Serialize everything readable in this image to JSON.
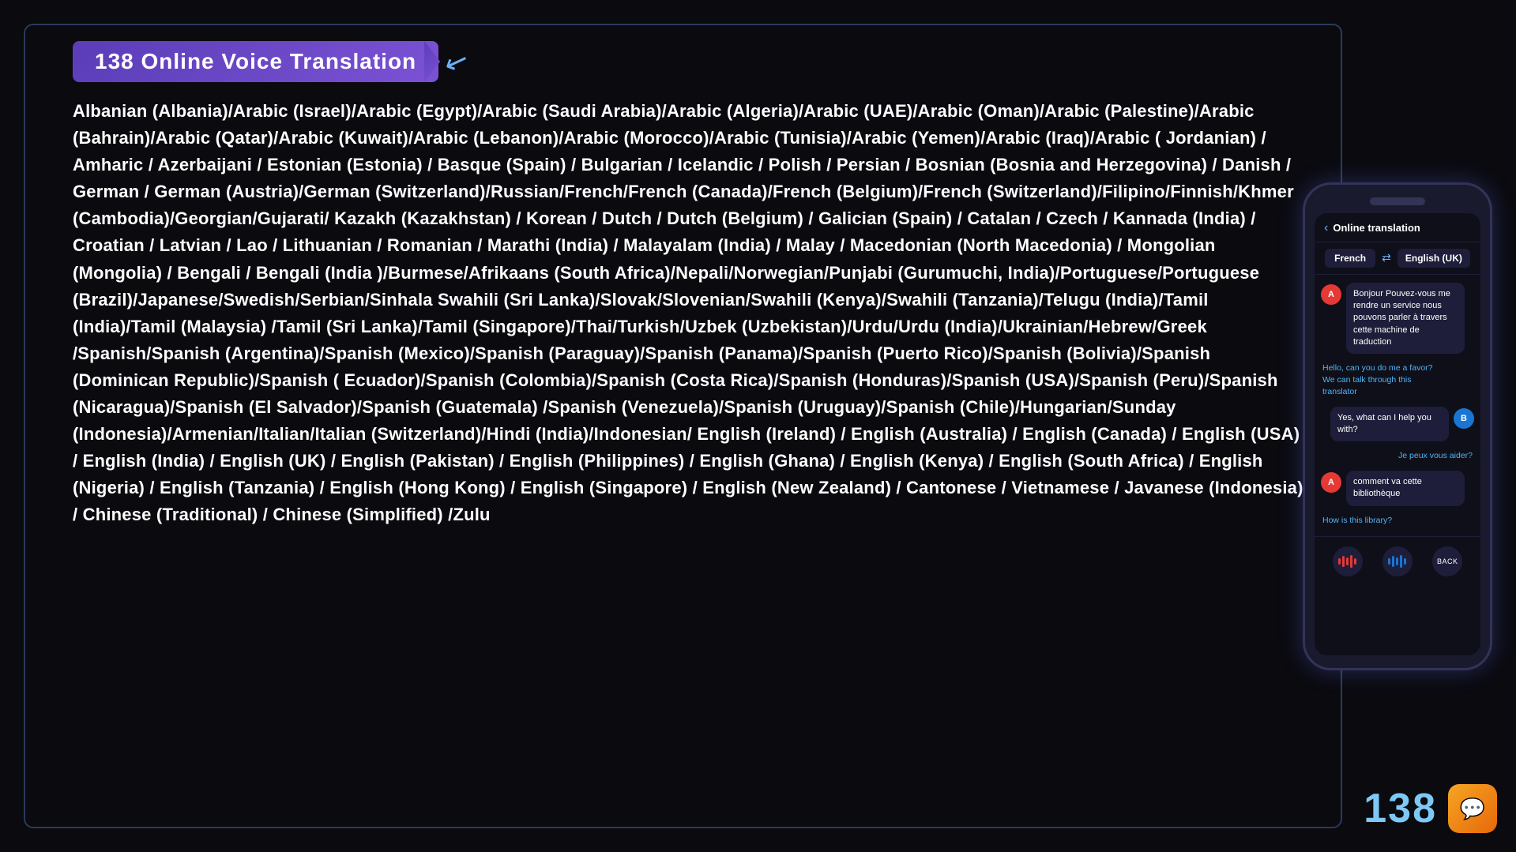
{
  "header": {
    "banner_title": "138 Online Voice Translation",
    "border_color": "#2a3a5c"
  },
  "languages_text": "Albanian (Albania)/Arabic (Israel)/Arabic (Egypt)/Arabic (Saudi Arabia)/Arabic (Algeria)/Arabic (UAE)/Arabic (Oman)/Arabic (Palestine)/Arabic (Bahrain)/Arabic (Qatar)/Arabic (Kuwait)/Arabic (Lebanon)/Arabic (Morocco)/Arabic (Tunisia)/Arabic (Yemen)/Arabic (Iraq)/Arabic ( Jordanian) / Amharic / Azerbaijani / Estonian (Estonia) / Basque (Spain) / Bulgarian / Icelandic / Polish / Persian / Bosnian (Bosnia and Herzegovina) / Danish / German / German (Austria)/German (Switzerland)/Russian/French/French (Canada)/French (Belgium)/French (Switzerland)/Filipino/Finnish/Khmer (Cambodia)/Georgian/Gujarati/ Kazakh (Kazakhstan) / Korean / Dutch / Dutch (Belgium) / Galician (Spain) / Catalan / Czech / Kannada (India) / Croatian / Latvian / Lao / Lithuanian / Romanian / Marathi (India) / Malayalam (India) / Malay / Macedonian (North Macedonia) / Mongolian (Mongolia) / Bengali / Bengali (India )/Burmese/Afrikaans (South Africa)/Nepali/Norwegian/Punjabi (Gurumuchi, India)/Portuguese/Portuguese (Brazil)/Japanese/Swedish/Serbian/Sinhala Swahili (Sri Lanka)/Slovak/Slovenian/Swahili (Kenya)/Swahili (Tanzania)/Telugu (India)/Tamil (India)/Tamil (Malaysia) /Tamil (Sri Lanka)/Tamil (Singapore)/Thai/Turkish/Uzbek (Uzbekistan)/Urdu/Urdu (India)/Ukrainian/Hebrew/Greek /Spanish/Spanish (Argentina)/Spanish (Mexico)/Spanish (Paraguay)/Spanish (Panama)/Spanish (Puerto Rico)/Spanish (Bolivia)/Spanish (Dominican Republic)/Spanish ( Ecuador)/Spanish (Colombia)/Spanish (Costa Rica)/Spanish (Honduras)/Spanish (USA)/Spanish (Peru)/Spanish (Nicaragua)/Spanish (El Salvador)/Spanish (Guatemala) /Spanish (Venezuela)/Spanish (Uruguay)/Spanish (Chile)/Hungarian/Sunday (Indonesia)/Armenian/Italian/Italian (Switzerland)/Hindi (India)/Indonesian/ English (Ireland) / English (Australia) / English (Canada) / English (USA) / English (India) / English (UK) / English (Pakistan) / English (Philippines) / English (Ghana) / English (Kenya) / English (South Africa) / English (Nigeria) / English (Tanzania) / English (Hong Kong) / English (Singapore) / English (New Zealand) / Cantonese / Vietnamese / Javanese (Indonesia) / Chinese (Traditional) / Chinese (Simplified) /Zulu",
  "phone": {
    "app_title": "Online translation",
    "back_label": "‹",
    "lang_from": "French",
    "lang_to": "English (UK)",
    "swap_icon": "⇄",
    "messages": [
      {
        "id": "msg1",
        "avatar": "A",
        "side": "left",
        "text": "Bonjour Pouvez-vous me rendre un service nous pouvons parler à travers cette machine de traduction",
        "translated": "Hello, can you do me a favor? We can talk through this translator"
      },
      {
        "id": "msg2",
        "avatar": "B",
        "side": "right",
        "text": "Yes, what can I help you with?",
        "translated": "Je peux vous aider?"
      },
      {
        "id": "msg3",
        "avatar": "A",
        "side": "left",
        "text": "comment va cette bibliothèque",
        "translated": "How is this library?"
      }
    ],
    "controls": {
      "mic_left_label": "🎤",
      "mic_right_label": "🎤",
      "back_label": "BACK"
    }
  },
  "branding": {
    "number": "138",
    "icon": "💬"
  }
}
